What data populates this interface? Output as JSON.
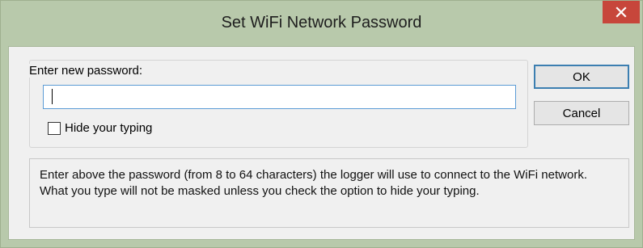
{
  "window": {
    "title": "Set WiFi Network Password",
    "close_icon": "close-icon",
    "accent_close": "#c7463b",
    "frame_color": "#b8c9ab"
  },
  "form": {
    "group_label": "Enter new password:",
    "password_value": "",
    "checkbox_label": "Hide your typing",
    "checkbox_checked": false
  },
  "buttons": {
    "ok_label": "OK",
    "cancel_label": "Cancel"
  },
  "info": {
    "text": "Enter above the password (from 8 to 64 characters) the logger will use to connect to the WiFi network.  What you type will not be masked unless you check the option to hide your typing."
  }
}
